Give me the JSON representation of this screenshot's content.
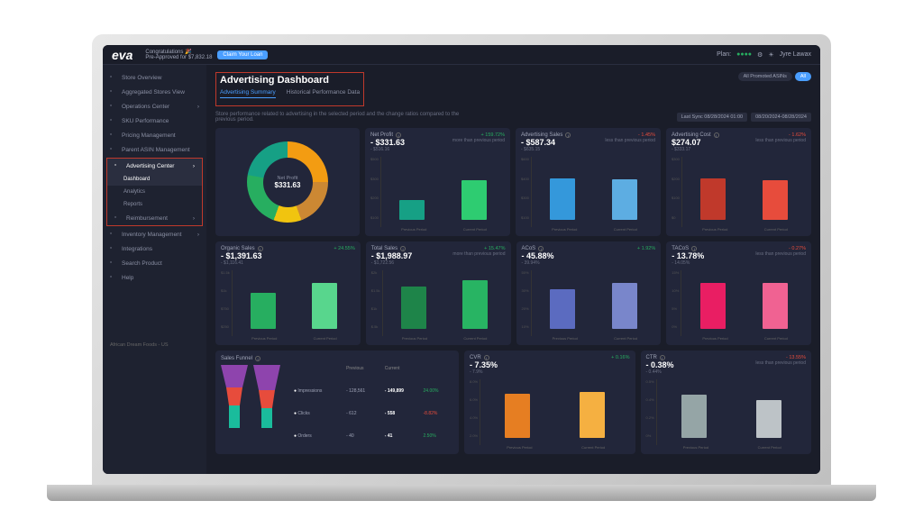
{
  "brand": "eva",
  "topbar": {
    "congrats_line1": "Congratulations 🎉",
    "congrats_line2": "Pre-Approved for $7,832.18",
    "claim_btn": "Claim Your Loan",
    "plan_label": "Plan:",
    "user": "Jyre Lawax"
  },
  "sidebar": {
    "items": [
      {
        "label": "Store Overview"
      },
      {
        "label": "Aggregated Stores View"
      },
      {
        "label": "Operations Center",
        "expand": true
      },
      {
        "label": "SKU Performance"
      },
      {
        "label": "Pricing Management"
      },
      {
        "label": "Parent ASIN Management"
      },
      {
        "label": "Advertising Center",
        "expand": true,
        "active": true
      },
      {
        "label": "Dashboard",
        "sub": true,
        "active": true
      },
      {
        "label": "Analytics",
        "sub": true
      },
      {
        "label": "Reports",
        "sub": true
      },
      {
        "label": "Reimbursement",
        "expand": true
      },
      {
        "label": "Inventory Management",
        "expand": true
      },
      {
        "label": "Integrations"
      },
      {
        "label": "Search Product"
      },
      {
        "label": "Help"
      }
    ],
    "footer": "African Dream Foods - US"
  },
  "page": {
    "title": "Advertising Dashboard",
    "tabs": [
      "Advertising Summary",
      "Historical Performance Data"
    ],
    "desc": "Store performance related to advertising in the selected period and the change ratios compared to the previous period.",
    "last_sync": "Last Sync 08/28/2024 01:00",
    "date_range": "08/20/2024-08/28/2024",
    "asin_pills": [
      "All Promoted ASINs",
      "All"
    ]
  },
  "donut": {
    "label": "Net Profit",
    "value": "$331.63"
  },
  "chart_data": [
    {
      "type": "bar",
      "title": "Net Profit",
      "value": "- $331.63",
      "sub": "- $516.16",
      "change": "+ 159.72%",
      "change_dir": "pos",
      "change_sub": "more than previous period",
      "ylim": [
        0,
        500
      ],
      "ticks": [
        "$500",
        "$300",
        "$200",
        "$100"
      ],
      "categories": [
        "Previous Period",
        "Current Period"
      ],
      "values": [
        200,
        400
      ],
      "colors": [
        "#16a085",
        "#2ecc71"
      ]
    },
    {
      "type": "bar",
      "title": "Advertising Sales",
      "value": "- $587.34",
      "sub": "- $635.15",
      "change": "- 1.45%",
      "change_dir": "neg",
      "change_sub": "less than previous period",
      "ylim": [
        0,
        600
      ],
      "ticks": [
        "$600",
        "$400",
        "$300",
        "$100"
      ],
      "categories": [
        "Previous Period",
        "Current Period"
      ],
      "values": [
        500,
        490
      ],
      "colors": [
        "#3498db",
        "#5dade2"
      ]
    },
    {
      "type": "bar",
      "title": "Advertising Cost",
      "value": "$274.07",
      "sub": "- $333.17",
      "change": "- 1.62%",
      "change_dir": "neg",
      "change_sub": "less than previous period",
      "ylim": [
        0,
        300
      ],
      "ticks": [
        "$300",
        "$200",
        "$100",
        "$0"
      ],
      "categories": [
        "Previous Period",
        "Current Period"
      ],
      "values": [
        250,
        240
      ],
      "colors": [
        "#c0392b",
        "#e74c3c"
      ]
    },
    {
      "type": "bar",
      "title": "Organic Sales",
      "value": "- $1,391.63",
      "sub": "- $1,116.41",
      "change": "+ 24.55%",
      "change_dir": "pos",
      "change_sub": "",
      "ylim": [
        0,
        1500
      ],
      "ticks": [
        "$1.5k",
        "$1k",
        "$750",
        "$250"
      ],
      "categories": [
        "Previous Period",
        "Current Period"
      ],
      "values": [
        1100,
        1400
      ],
      "colors": [
        "#27ae60",
        "#58d68d"
      ]
    },
    {
      "type": "bar",
      "title": "Total Sales",
      "value": "- $1,988.97",
      "sub": "- $1,722.56",
      "change": "+ 15.47%",
      "change_dir": "pos",
      "change_sub": "more than previous period",
      "ylim": [
        0,
        2000
      ],
      "ticks": [
        "$2k",
        "$1.5k",
        "$1k",
        "$.5k"
      ],
      "categories": [
        "Previous Period",
        "Current Period"
      ],
      "values": [
        1700,
        1980
      ],
      "colors": [
        "#1e8449",
        "#28b463"
      ]
    },
    {
      "type": "bar",
      "title": "ACoS",
      "value": "- 45.88%",
      "sub": "- 39.94%",
      "change": "+ 1.92%",
      "change_dir": "pos",
      "change_sub": "",
      "ylim": [
        0,
        50
      ],
      "ticks": [
        "50%",
        "30%",
        "20%",
        "10%"
      ],
      "categories": [
        "Previous Period",
        "Current Period"
      ],
      "values": [
        40,
        46
      ],
      "colors": [
        "#5b6bc0",
        "#7986cb"
      ]
    },
    {
      "type": "bar",
      "title": "TACoS",
      "value": "- 13.78%",
      "sub": "- 14.05%",
      "change": "- 0.27%",
      "change_dir": "neg",
      "change_sub": "less than previous period",
      "ylim": [
        0,
        15
      ],
      "ticks": [
        "15%",
        "10%",
        "5%",
        "0%"
      ],
      "categories": [
        "Previous Period",
        "Current Period"
      ],
      "values": [
        14,
        13.8
      ],
      "colors": [
        "#e91e63",
        "#f06292"
      ]
    },
    {
      "type": "bar",
      "title": "CVR",
      "value": "- 7.35%",
      "sub": "- 7.9%",
      "change": "+ 0.16%",
      "change_dir": "pos",
      "change_sub": "",
      "ylim": [
        0,
        8
      ],
      "ticks": [
        "8.0%",
        "6.0%",
        "4.0%",
        "2.0%"
      ],
      "categories": [
        "Previous Period",
        "Current Period"
      ],
      "values": [
        7.2,
        7.4
      ],
      "colors": [
        "#e67e22",
        "#f5b041"
      ]
    },
    {
      "type": "bar",
      "title": "CTR",
      "value": "- 0.38%",
      "sub": "- 0.44%",
      "change": "- 13.55%",
      "change_dir": "neg",
      "change_sub": "less than previous period",
      "ylim": [
        0,
        0.5
      ],
      "ticks": [
        "0.5%",
        "0.4%",
        "0.2%",
        "0%"
      ],
      "categories": [
        "Previous Period",
        "Current Period"
      ],
      "values": [
        0.44,
        0.38
      ],
      "colors": [
        "#95a5a6",
        "#bdc3c7"
      ]
    }
  ],
  "funnel": {
    "title": "Sales Funnel",
    "cols": [
      "",
      "Previous",
      "Current",
      ""
    ],
    "rows": [
      {
        "dot": "#fff",
        "label": "Impressions",
        "prev": "128,561",
        "curr": "149,899",
        "pct": "24.00%",
        "dir": "pos"
      },
      {
        "dot": "#fff",
        "label": "Clicks",
        "prev": "612",
        "curr": "558",
        "pct": "-8.82%",
        "dir": "neg"
      },
      {
        "dot": "#fff",
        "label": "Orders",
        "prev": "40",
        "curr": "41",
        "pct": "2.50%",
        "dir": "pos"
      }
    ]
  }
}
